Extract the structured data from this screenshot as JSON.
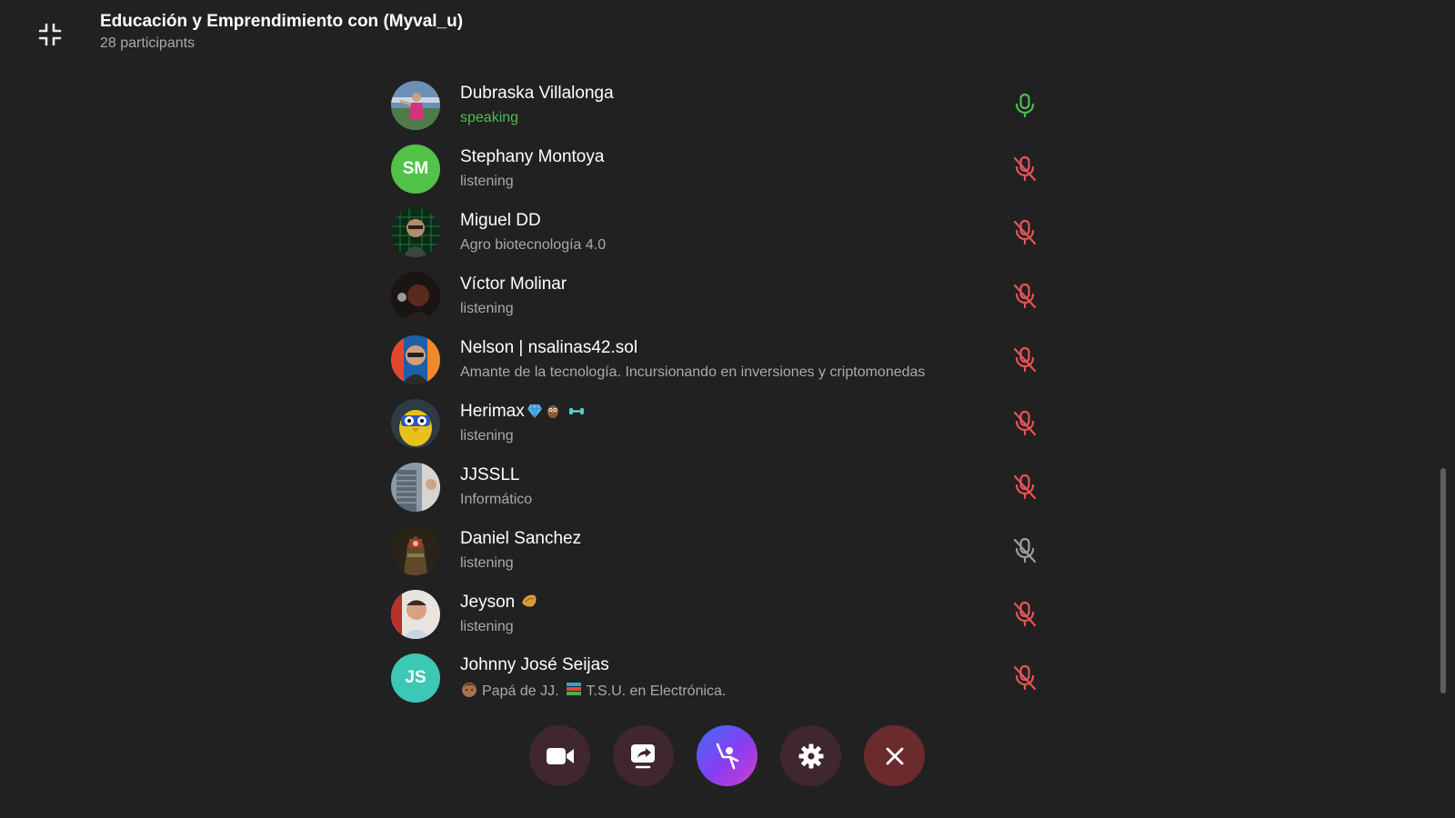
{
  "header": {
    "title": "Educación y Emprendimiento con (Myval_u)",
    "participants": "28 participants"
  },
  "colors": {
    "background": "#212121",
    "speaking": "#4dbd52",
    "muted": "#e5535a",
    "muted_gray": "#9e9e9e"
  },
  "participants": [
    {
      "name": "Dubraska Villalonga",
      "status": "speaking",
      "mic": "mic-icon",
      "mic_state": "speaking"
    },
    {
      "name": "Stephany Montoya",
      "status": "listening",
      "avatar_initials": "SM",
      "mic": "mic-muted-icon",
      "mic_state": "muted"
    },
    {
      "name": "Miguel DD",
      "status": "Agro biotecnología 4.0",
      "mic": "mic-muted-icon",
      "mic_state": "muted"
    },
    {
      "name": "Víctor Molinar",
      "status": "listening",
      "mic": "mic-muted-icon",
      "mic_state": "muted"
    },
    {
      "name": "Nelson | nsalinas42.sol",
      "status": "Amante de la tecnología. Incursionando en inversiones y criptomonedas",
      "mic": "mic-muted-icon",
      "mic_state": "muted"
    },
    {
      "name": "Herimax",
      "status": "listening",
      "name_icons": [
        "gem-icon",
        "owl-icon",
        "dumbbell-icon"
      ],
      "mic": "mic-muted-icon",
      "mic_state": "muted"
    },
    {
      "name": "JJSSLL",
      "status": "Informático",
      "mic": "mic-muted-icon",
      "mic_state": "muted"
    },
    {
      "name": "Daniel Sanchez",
      "status": "listening",
      "mic": "mic-muted-icon",
      "mic_state": "muted-gray"
    },
    {
      "name": "Jeyson",
      "status": "listening",
      "name_icons": [
        "fortune-cookie-icon"
      ],
      "mic": "mic-muted-icon",
      "mic_state": "muted"
    },
    {
      "name": "Johnny José Seijas",
      "status_prefix_icon": "boy-icon",
      "status_part1": "Papá de ",
      "status_mid": "JJ.",
      "status_icon": "books-icon",
      "status_part2": "T.S.U. en Electrónica.",
      "avatar_initials": "JS",
      "mic": "mic-muted-icon",
      "mic_state": "muted"
    }
  ],
  "controls": [
    {
      "icon": "video-camera-icon"
    },
    {
      "icon": "screen-share-icon"
    },
    {
      "icon": "raise-hand-icon"
    },
    {
      "icon": "gear-icon"
    },
    {
      "icon": "close-icon"
    }
  ]
}
